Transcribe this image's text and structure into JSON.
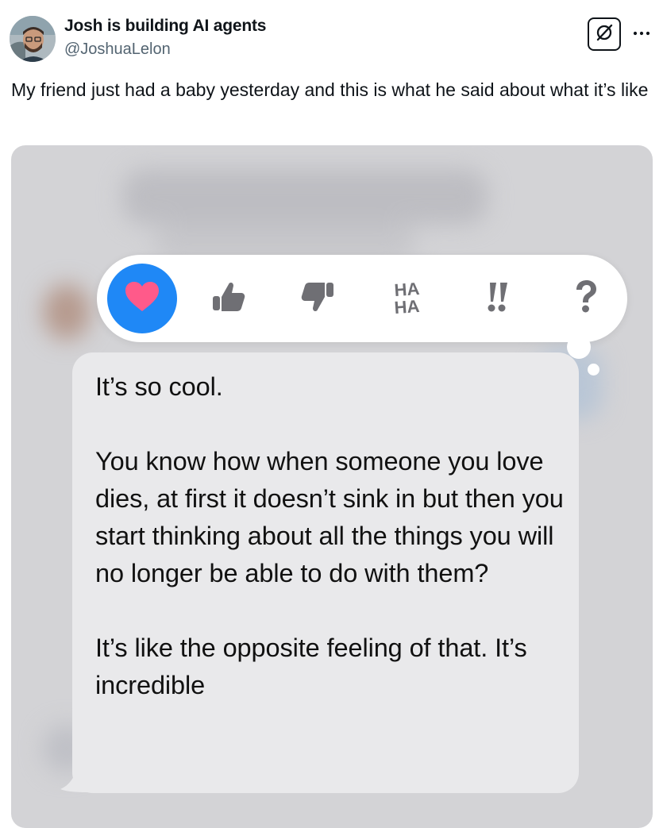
{
  "author": {
    "display_name": "Josh is building AI agents",
    "handle": "@JoshuaLelon"
  },
  "icons": {
    "avatar": "avatar-photo",
    "grok": "grok-icon",
    "more": "more-dots-icon"
  },
  "tweet": {
    "text": "My friend just had a baby yesterday and this is what he said about what it’s like"
  },
  "screenshot": {
    "reactions": [
      {
        "name": "heart",
        "label": "",
        "selected": true
      },
      {
        "name": "thumbs-up",
        "label": ""
      },
      {
        "name": "thumbs-down",
        "label": ""
      },
      {
        "name": "haha",
        "label": "HA\nHA"
      },
      {
        "name": "emphasize",
        "label": "!!"
      },
      {
        "name": "question",
        "label": "?"
      }
    ],
    "message": "It’s so cool.\n\nYou know how when someone you love dies, at first it doesn’t sink in but then you start thinking about all the things you will no longer be able to do with them?\n\nIt’s like the opposite feeling of that. It’s incredible"
  },
  "colors": {
    "heart_bg": "#1f88f6",
    "heart": "#ff5a8a",
    "reaction_icon": "#6f6f74",
    "bubble": "#e9e9eb",
    "handle": "#536471"
  }
}
